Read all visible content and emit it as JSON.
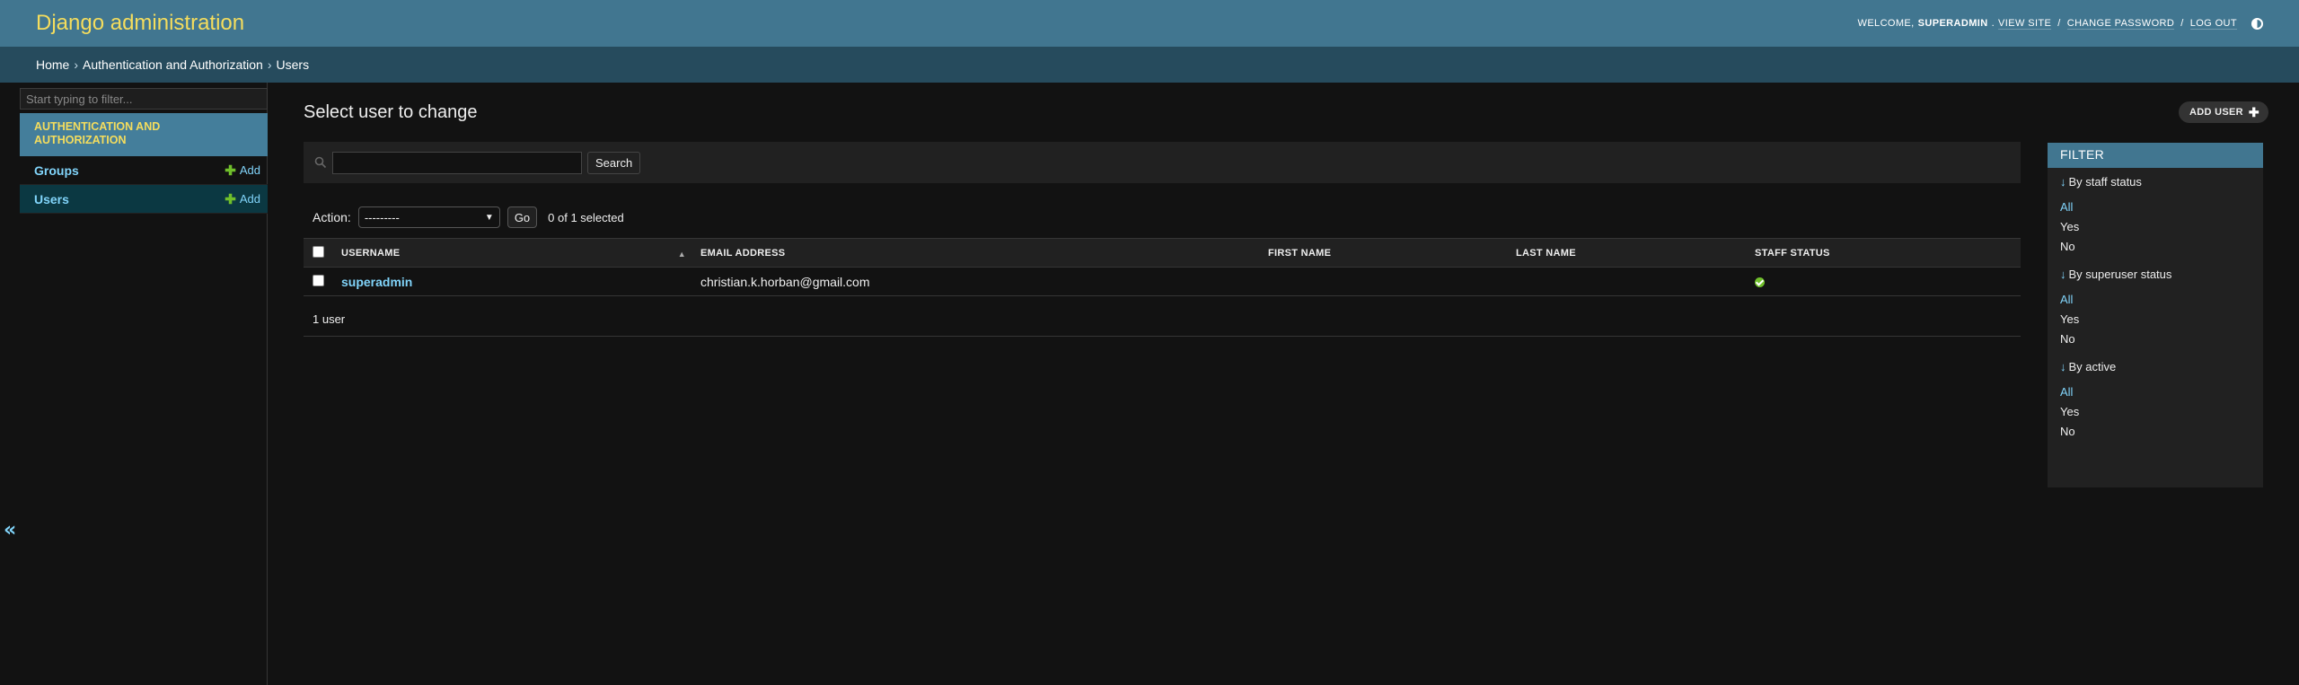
{
  "header": {
    "site_name": "Django administration",
    "welcome": "Welcome,",
    "username": "superadmin",
    "view_site": "View site",
    "change_password": "Change password",
    "logout": "Log out",
    "theme_icon": "theme-toggle-icon"
  },
  "breadcrumbs": {
    "home": "Home",
    "app": "Authentication and Authorization",
    "current": "Users",
    "separator": "›"
  },
  "sidebar": {
    "filter_placeholder": "Start typing to filter...",
    "app_caption": "Authentication and Authorization",
    "models": [
      {
        "name": "Groups",
        "add_label": "Add"
      },
      {
        "name": "Users",
        "add_label": "Add"
      }
    ],
    "collapse_icon": "«"
  },
  "main": {
    "title": "Select user to change",
    "add_button_label": "Add user",
    "search": {
      "value": "",
      "button_label": "Search"
    },
    "actions": {
      "label": "Action:",
      "selected_option": "---------",
      "go_label": "Go",
      "selection_count": "0 of 1 selected"
    },
    "table": {
      "columns": [
        "Username",
        "Email address",
        "First name",
        "Last name",
        "Staff status"
      ],
      "rows": [
        {
          "username": "superadmin",
          "email": "christian.k.horban@gmail.com",
          "first_name": "",
          "last_name": "",
          "staff_status": true
        }
      ]
    },
    "paginator": "1 user"
  },
  "filter": {
    "title": "Filter",
    "groups": [
      {
        "title": "By staff status",
        "options": [
          "All",
          "Yes",
          "No"
        ],
        "selected": "All"
      },
      {
        "title": "By superuser status",
        "options": [
          "All",
          "Yes",
          "No"
        ],
        "selected": "All"
      },
      {
        "title": "By active",
        "options": [
          "All",
          "Yes",
          "No"
        ],
        "selected": "All"
      }
    ]
  },
  "colors": {
    "header_bg": "#417690",
    "breadcrumbs_bg": "#264b5d",
    "brand_yellow": "#f5dd5d",
    "link_blue": "#81d4fa",
    "success_green": "#70bf2b",
    "body_bg": "#121212"
  }
}
